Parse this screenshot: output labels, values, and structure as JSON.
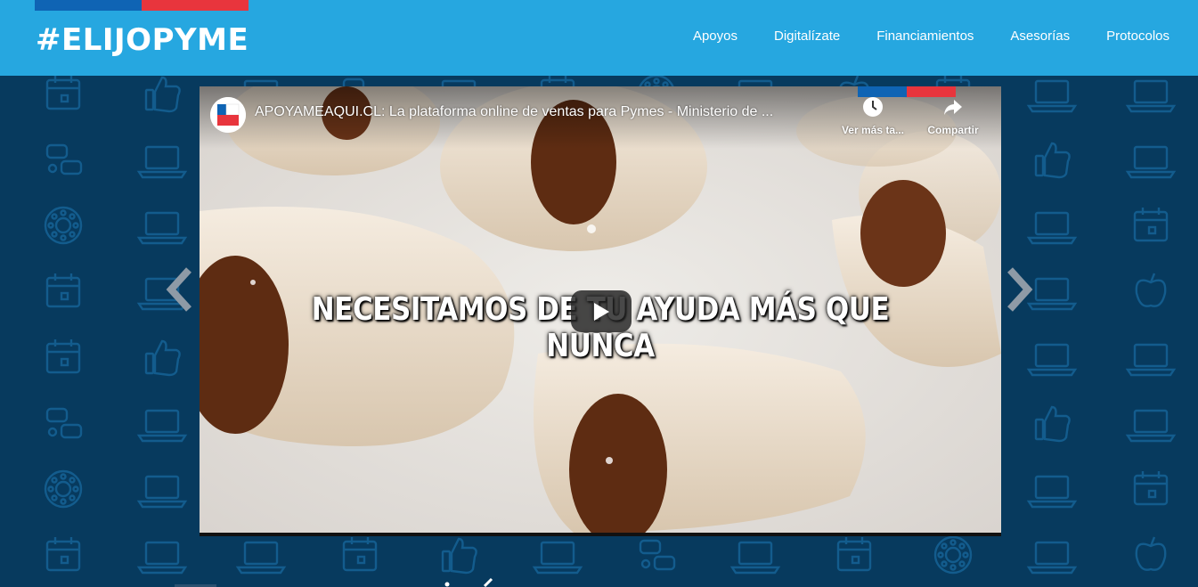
{
  "header": {
    "logo_text": "#ELIJOPYME",
    "nav": [
      "Apoyos",
      "Digitalízate",
      "Financiamientos",
      "Asesorías",
      "Protocolos"
    ],
    "bg_color": "#26a7e0",
    "flag_colors": [
      "#0f64b4",
      "#e8353d"
    ]
  },
  "hero": {
    "bg_color": "#073a5e",
    "pattern_icons": [
      "laptop-icon",
      "calendar-icon",
      "thumbs-up-icon",
      "chat-icon",
      "apple-icon",
      "dots-circle-icon"
    ],
    "prev_icon": "chevron-left-icon",
    "next_icon": "chevron-right-icon"
  },
  "video": {
    "title": "APOYAMEAQUI.CL: La plataforma online de ventas para Pymes - Ministerio de ...",
    "watch_later_label": "Ver más ta...",
    "share_label": "Compartir",
    "caption": "NECESITAMOS DE TU AYUDA MÁS QUE NUNCA",
    "play_icon": "play-icon"
  }
}
